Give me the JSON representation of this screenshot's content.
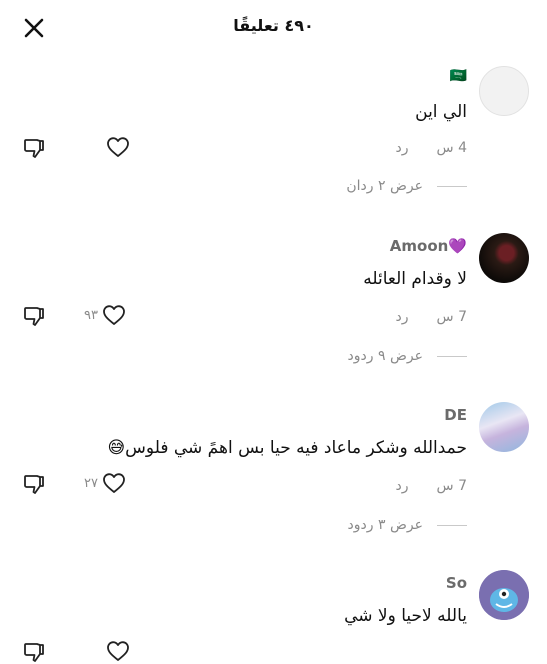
{
  "header": {
    "title": "٤٩٠ تعليقًا",
    "close_icon": "close-icon"
  },
  "colors": {
    "text": "#111111",
    "muted": "#8a8a8a",
    "username": "#6b6b6b",
    "divider": "#c9c9c9"
  },
  "comments": [
    {
      "username": "🇸🇦",
      "text": "الي اين",
      "time": "4 س",
      "reply_label": "رد",
      "likes": "",
      "view_replies": "عرض ٢ ردان"
    },
    {
      "username": "Amoon💜",
      "text": "لا وقدام العائله",
      "time": "7 س",
      "reply_label": "رد",
      "likes": "٩٣",
      "view_replies": "عرض ٩ ردود"
    },
    {
      "username": "DE",
      "text": "حمدالله وشكر ماعاد فيه حيا بس اهمً شي فلوس😅",
      "time": "7 س",
      "reply_label": "رد",
      "likes": "٢٧",
      "view_replies": "عرض ٣ ردود"
    },
    {
      "username": "So",
      "text": "يالله لاحيا ولا شي",
      "time": "",
      "reply_label": "",
      "likes": "",
      "view_replies": ""
    }
  ]
}
